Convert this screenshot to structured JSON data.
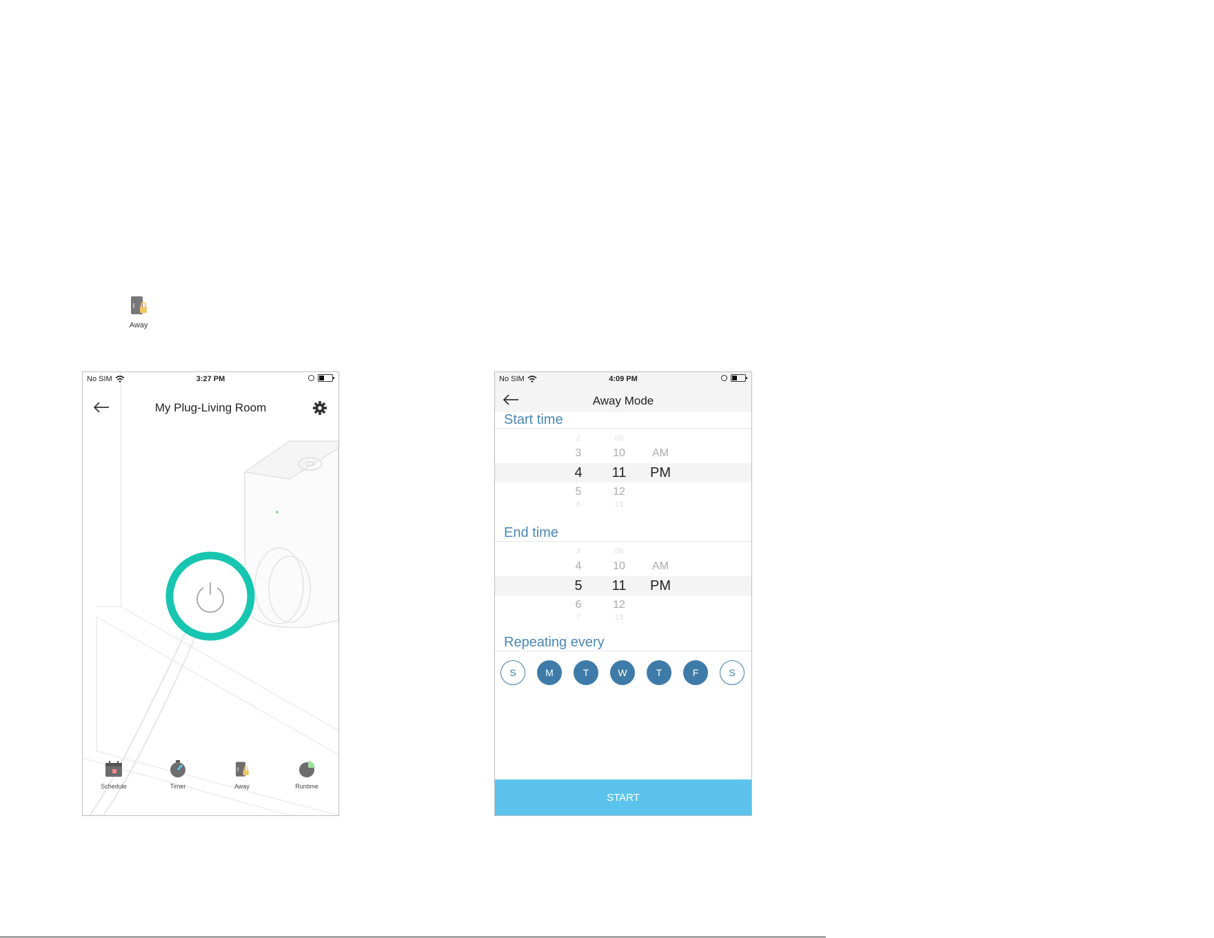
{
  "floating_away": {
    "label": "Away"
  },
  "phone1": {
    "status": {
      "carrier": "No SIM",
      "time": "3:27 PM"
    },
    "header": {
      "title": "My Plug-Living Room"
    },
    "power": {
      "state": "on",
      "ring_color": "#17c5b0"
    },
    "nav": [
      {
        "label": "Schedule",
        "icon": "calendar-icon"
      },
      {
        "label": "Timer",
        "icon": "stopwatch-icon"
      },
      {
        "label": "Away",
        "icon": "away-icon"
      },
      {
        "label": "Runtime",
        "icon": "pie-chart-icon"
      }
    ]
  },
  "phone2": {
    "status": {
      "carrier": "No SIM",
      "time": "4:09 PM"
    },
    "header": {
      "title": "Away Mode"
    },
    "start_time": {
      "title": "Start time",
      "hours": [
        "2",
        "3",
        "4",
        "5",
        "6"
      ],
      "minutes": [
        "09",
        "10",
        "11",
        "12",
        "13"
      ],
      "ampm": [
        "AM",
        "PM"
      ],
      "selected": {
        "hour": "4",
        "minute": "11",
        "ampm": "PM"
      }
    },
    "end_time": {
      "title": "End time",
      "hours": [
        "3",
        "4",
        "5",
        "6",
        "7"
      ],
      "minutes": [
        "09",
        "10",
        "11",
        "12",
        "13"
      ],
      "ampm": [
        "AM",
        "PM"
      ],
      "selected": {
        "hour": "5",
        "minute": "11",
        "ampm": "PM"
      }
    },
    "repeating": {
      "title": "Repeating every",
      "days": [
        {
          "label": "S",
          "selected": false
        },
        {
          "label": "M",
          "selected": true
        },
        {
          "label": "T",
          "selected": true
        },
        {
          "label": "W",
          "selected": true
        },
        {
          "label": "T",
          "selected": true
        },
        {
          "label": "F",
          "selected": true
        },
        {
          "label": "S",
          "selected": false
        }
      ]
    },
    "start_button": "START",
    "accent": "#3f7ba8",
    "button_color": "#5cc4ec"
  }
}
